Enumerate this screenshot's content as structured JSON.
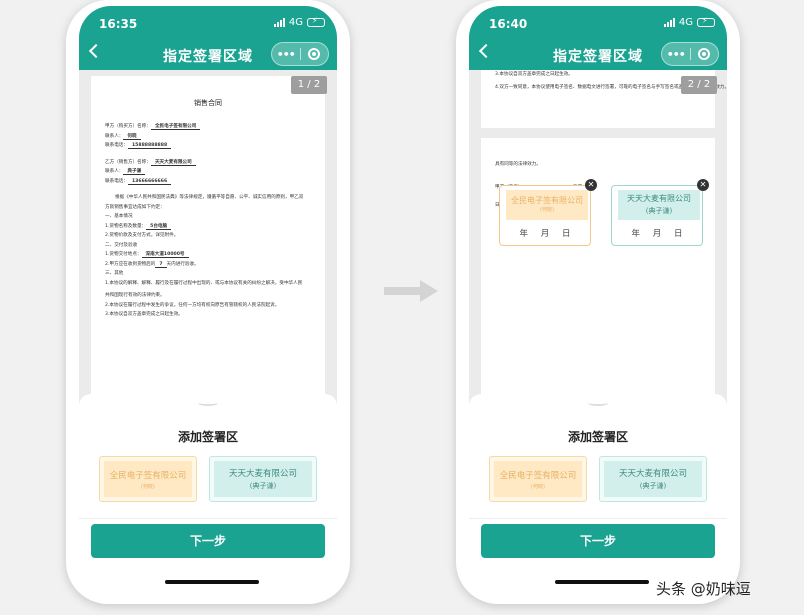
{
  "left": {
    "status": {
      "time": "16:35",
      "network": "4G"
    },
    "nav": {
      "title": "指定签署区域"
    },
    "page_badge": "1 / 2",
    "doc": {
      "title": "销售合同",
      "lines": [
        [
          "甲方（购买方）名称：",
          "全民电子签有限公司"
        ],
        [
          "联系人：",
          "何晓"
        ],
        [
          "联系电话：",
          "15888888888"
        ],
        [
          "乙方（销售方）名称：",
          "天天大麦有限公司"
        ],
        [
          "联系人：",
          "典子谦"
        ],
        [
          "联系电话：",
          "13666666666"
        ]
      ],
      "para1": "根据《中华人民共和国民法典》等法律规定，遵循平等自愿、公平、诚实信用的原则，甲乙双",
      "para2": "方就销售事宜达成如下约定：",
      "sec1": "一、基本情况",
      "item1": "1.货物名称及数量：",
      "item1_val": "5台电脑",
      "item2": "2.货物价款及支付方式，详见附件。",
      "sec2": "二、交付及验收",
      "item3": "1.货物交付地点：",
      "item3_val": "深南大道10000号",
      "item4a": "2.甲方应在收到货物后的",
      "item4_val": "7",
      "item4b": "天内进行验收。",
      "sec3": "三、其他",
      "item5": "1.本协议的解释、解释、履行及在履行过程中出现的、或与本协议有关的纠纷之解决，受中华人民",
      "item6": "共和国现行有效的法律约束。",
      "item7": "2.本协议在履行过程中发生的争议，任何一方均有权向原告有管辖权的人民法院起诉。",
      "item8": "3.本协议自双方盖章完成之日起生效。"
    },
    "sheet": {
      "title": "添加签署区",
      "stamp_a": {
        "name": "全民电子签有限公司",
        "sub": "(何晓)"
      },
      "stamp_b": {
        "name": "天天大麦有限公司",
        "sub": "(典子谦)"
      },
      "next": "下一步"
    }
  },
  "right": {
    "status": {
      "time": "16:40",
      "network": "4G"
    },
    "nav": {
      "title": "指定签署区域"
    },
    "page_badge": "2 / 2",
    "doc": {
      "top1": "3.本协议自双方盖章完成之日起生效。",
      "top2": "4.双方一致同意，本协议使用电子签名、数据电文进行签署，可靠的电子签名与手写签名或盖章具有同等法律效力。",
      "p2": "具有同等的法律效力。",
      "party_a": "甲方（盖章）：",
      "party_b": "乙方",
      "date_label": "日期：",
      "placed_a": {
        "name": "全民电子签有限公司",
        "sub": "(何晓)",
        "date": "年 月 日"
      },
      "placed_b": {
        "name": "天天大麦有限公司",
        "sub": "(典子谦)",
        "date": "年 月 日"
      }
    },
    "sheet": {
      "title": "添加签署区",
      "stamp_a": {
        "name": "全民电子签有限公司",
        "sub": "(何晓)"
      },
      "stamp_b": {
        "name": "天天大麦有限公司",
        "sub": "(典子谦)"
      },
      "next": "下一步"
    }
  },
  "watermark": "头条 @奶味逗",
  "colors": {
    "brand": "#1aa391",
    "stamp_a": "#ffe9c4",
    "stamp_b": "#d3efeb"
  }
}
